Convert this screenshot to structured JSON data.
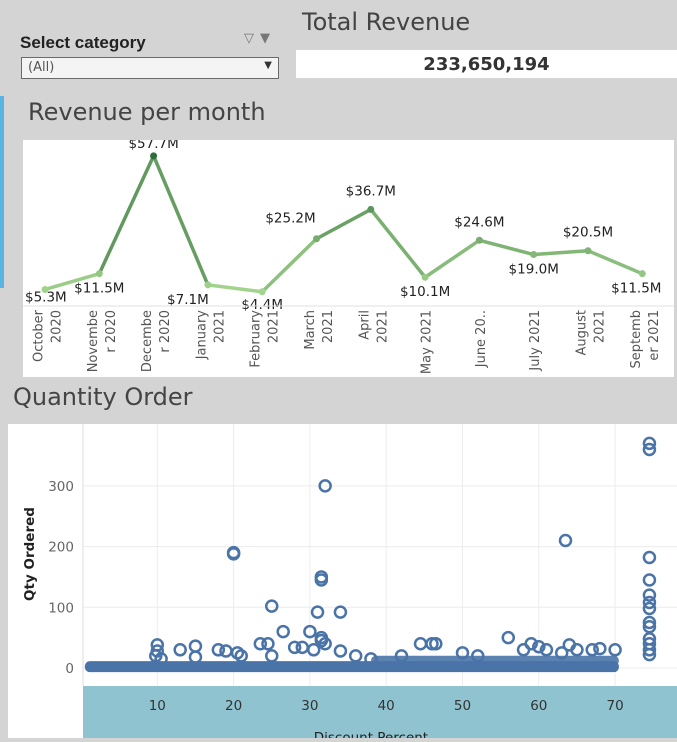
{
  "filter": {
    "title": "Select category",
    "selected": "(All)",
    "icons": [
      "filter-icon",
      "chevron-down-icon"
    ]
  },
  "total_revenue": {
    "title": "Total Revenue",
    "value": "233,650,194"
  },
  "revenue_chart": {
    "title": "Revenue per month"
  },
  "quantity_chart": {
    "title": "Quantity Order"
  },
  "colors": {
    "line_light": "#a5d68f",
    "line_dark": "#2e6b3a",
    "scatter": "#4a74a8",
    "axis_band": "#8ec3cf"
  },
  "chart_data": [
    {
      "type": "line",
      "categories": [
        "October 2020",
        "November 2020",
        "December 2020",
        "January 2021",
        "February 2021",
        "March 2021",
        "April 2021",
        "May 2021",
        "June 2021",
        "July 2021",
        "August 2021",
        "September 2021"
      ],
      "tick_labels": [
        [
          "October",
          "2020"
        ],
        [
          "Novembe",
          "r 2020"
        ],
        [
          "Decembe",
          "r 2020"
        ],
        [
          "January",
          "2021"
        ],
        [
          "February",
          "2021"
        ],
        [
          "March",
          "2021"
        ],
        [
          "April",
          "2021"
        ],
        [
          "May 2021"
        ],
        [
          "June 20.."
        ],
        [
          "July 2021"
        ],
        [
          "August",
          "2021"
        ],
        [
          "Septemb",
          "er 2021"
        ]
      ],
      "values": [
        5.3,
        11.5,
        57.7,
        7.1,
        4.4,
        25.2,
        36.7,
        10.1,
        24.6,
        19.0,
        20.5,
        11.5
      ],
      "data_labels": [
        "$5.3M",
        "$11.5M",
        "$57.7M",
        "$7.1M",
        "$4.4M",
        "$25.2M",
        "$36.7M",
        "$10.1M",
        "$24.6M",
        "$19.0M",
        "$20.5M",
        "$11.5M"
      ],
      "ylim": [
        0,
        60
      ],
      "grid": false
    },
    {
      "type": "scatter",
      "xlabel": "Discount Percent",
      "ylabel": "Qty Ordered",
      "xticks": [
        10,
        20,
        30,
        40,
        50,
        60,
        70
      ],
      "yticks": [
        0,
        100,
        200,
        300
      ],
      "xlim": [
        0,
        78
      ],
      "ylim": [
        -30,
        390
      ],
      "grid": true,
      "points": [
        [
          10,
          38
        ],
        [
          10,
          28
        ],
        [
          9.8,
          20
        ],
        [
          10.5,
          15
        ],
        [
          13,
          30
        ],
        [
          15,
          36
        ],
        [
          15,
          18
        ],
        [
          18,
          30
        ],
        [
          19,
          28
        ],
        [
          20,
          190
        ],
        [
          20,
          188
        ],
        [
          20.5,
          25
        ],
        [
          21,
          20
        ],
        [
          23.5,
          40
        ],
        [
          24.5,
          40
        ],
        [
          25,
          102
        ],
        [
          25,
          20
        ],
        [
          26.5,
          60
        ],
        [
          28,
          34
        ],
        [
          29,
          34
        ],
        [
          30,
          60
        ],
        [
          30.5,
          30
        ],
        [
          31,
          92
        ],
        [
          31.5,
          150
        ],
        [
          31.5,
          145
        ],
        [
          31.5,
          50
        ],
        [
          31.5,
          45
        ],
        [
          32,
          300
        ],
        [
          32,
          40
        ],
        [
          34,
          92
        ],
        [
          34,
          28
        ],
        [
          36,
          20
        ],
        [
          38,
          15
        ],
        [
          42,
          20
        ],
        [
          44.5,
          40
        ],
        [
          46,
          40
        ],
        [
          46.5,
          40
        ],
        [
          50,
          25
        ],
        [
          52,
          20
        ],
        [
          56,
          50
        ],
        [
          58,
          30
        ],
        [
          59,
          40
        ],
        [
          60,
          35
        ],
        [
          61,
          30
        ],
        [
          63,
          25
        ],
        [
          63.5,
          210
        ],
        [
          64,
          38
        ],
        [
          65,
          30
        ],
        [
          67,
          30
        ],
        [
          68,
          32
        ],
        [
          70,
          30
        ],
        [
          74.5,
          370
        ],
        [
          74.5,
          360
        ],
        [
          74.5,
          182
        ],
        [
          74.5,
          145
        ],
        [
          74.5,
          120
        ],
        [
          74.5,
          108
        ],
        [
          74.5,
          98
        ],
        [
          74.5,
          75
        ],
        [
          74.5,
          68
        ],
        [
          74.5,
          48
        ],
        [
          74.5,
          40
        ],
        [
          74.5,
          30
        ],
        [
          74.5,
          22
        ]
      ]
    }
  ]
}
